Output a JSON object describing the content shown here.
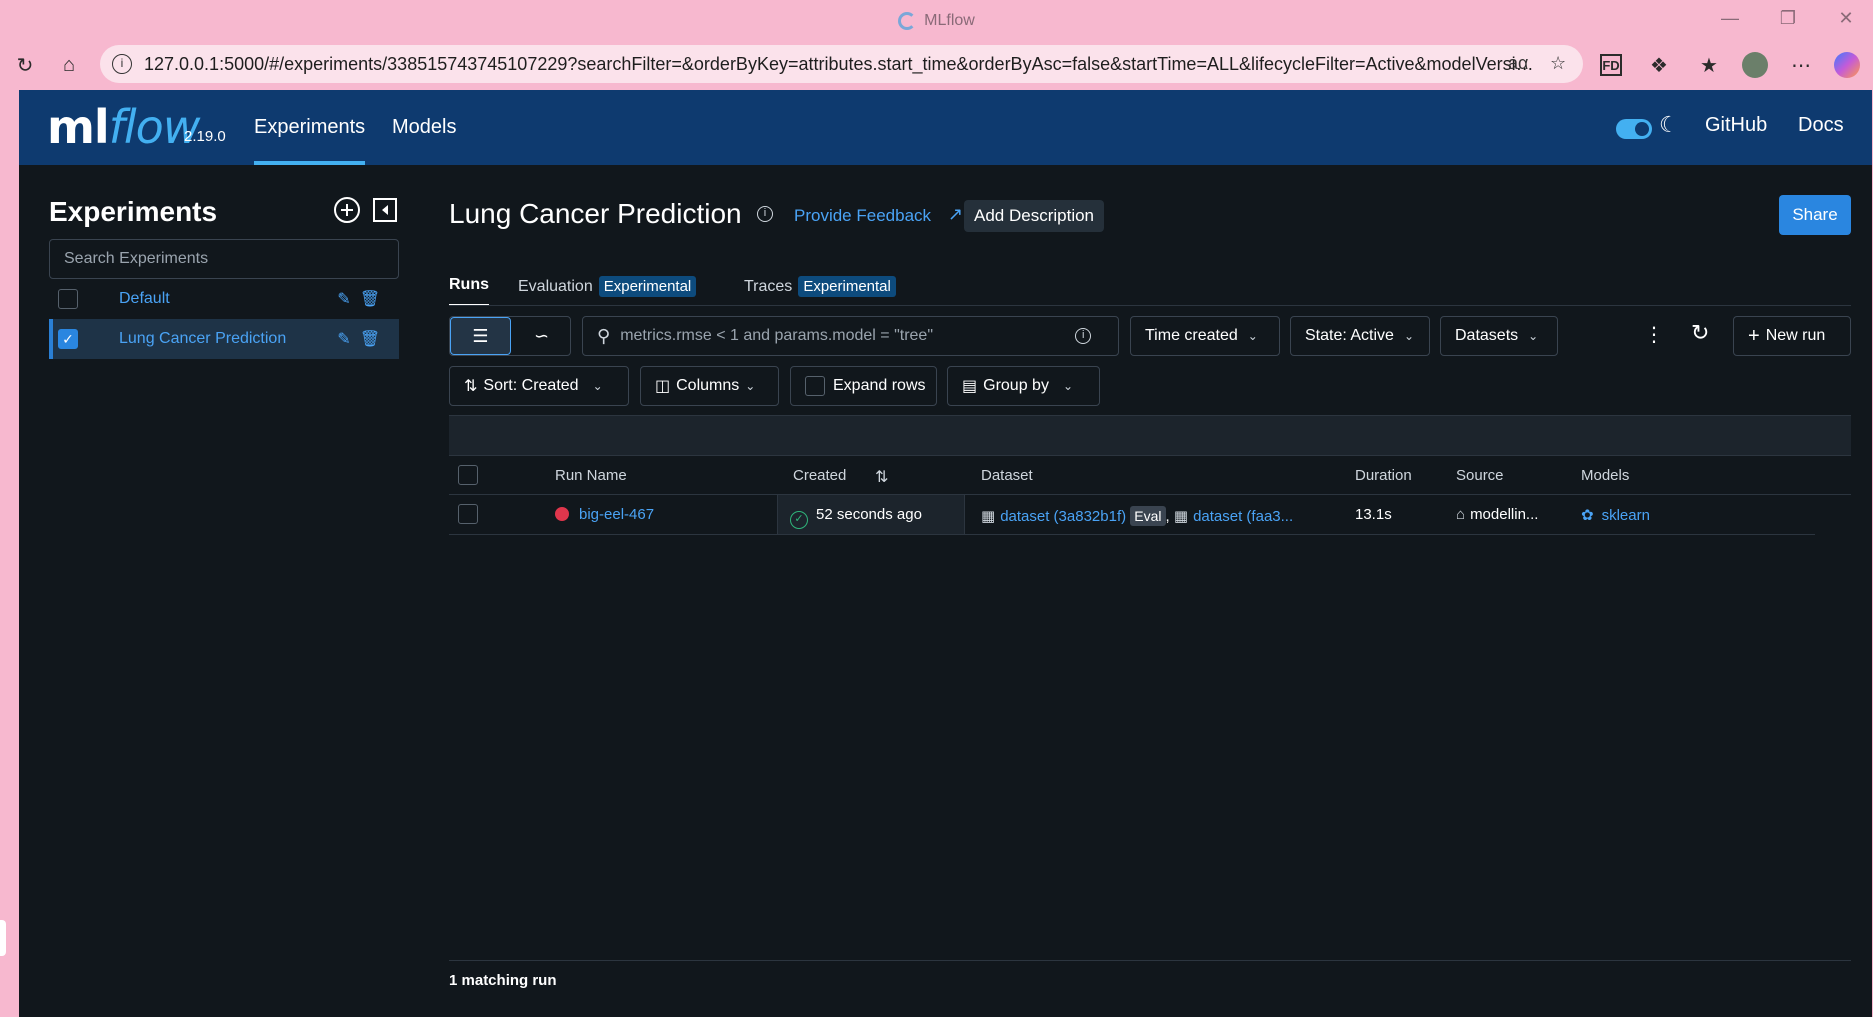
{
  "browser": {
    "window_title": "MLflow",
    "url": "127.0.0.1:5000/#/experiments/338515743745107229?searchFilter=&orderByKey=attributes.start_time&orderByAsc=false&startTime=ALL&lifecycleFilter=Active&modelVersio..."
  },
  "header": {
    "logo_ml": "ml",
    "logo_flow": "flow",
    "version": "2.19.0",
    "nav": [
      "Experiments",
      "Models"
    ],
    "links": [
      "GitHub",
      "Docs"
    ]
  },
  "sidebar": {
    "title": "Experiments",
    "search_placeholder": "Search Experiments",
    "experiments": [
      {
        "name": "Default",
        "checked": false
      },
      {
        "name": "Lung Cancer Prediction",
        "checked": true
      }
    ]
  },
  "main": {
    "title": "Lung Cancer Prediction",
    "feedback": "Provide Feedback",
    "add_description": "Add Description",
    "share": "Share",
    "tabs": [
      {
        "label": "Runs",
        "badge": ""
      },
      {
        "label": "Evaluation",
        "badge": "Experimental"
      },
      {
        "label": "Traces",
        "badge": "Experimental"
      }
    ],
    "search_placeholder": "metrics.rmse < 1 and params.model = \"tree\"",
    "filters": {
      "time": "Time created",
      "state": "State: Active",
      "datasets": "Datasets",
      "new_run": "New run",
      "sort": "Sort: Created",
      "columns": "Columns",
      "expand_rows": "Expand rows",
      "group_by": "Group by"
    },
    "table": {
      "headers": [
        "Run Name",
        "Created",
        "Dataset",
        "Duration",
        "Source",
        "Models"
      ],
      "rows": [
        {
          "run_name": "big-eel-467",
          "created": "52 seconds ago",
          "dataset1": "dataset (3a832b1f)",
          "eval_tag": "Eval",
          "separator": ",",
          "dataset2": "dataset (faa3...",
          "duration": "13.1s",
          "source": "modellin...",
          "model": "sklearn"
        }
      ]
    },
    "footer": "1 matching run"
  },
  "colors": {
    "header_bg": "#0e3a6f",
    "app_bg": "#11171c",
    "accent": "#43b0f1",
    "link": "#4aa3f5",
    "primary_button": "#2a86e0",
    "run_status": "#e0364c",
    "success": "#2fb47a"
  }
}
